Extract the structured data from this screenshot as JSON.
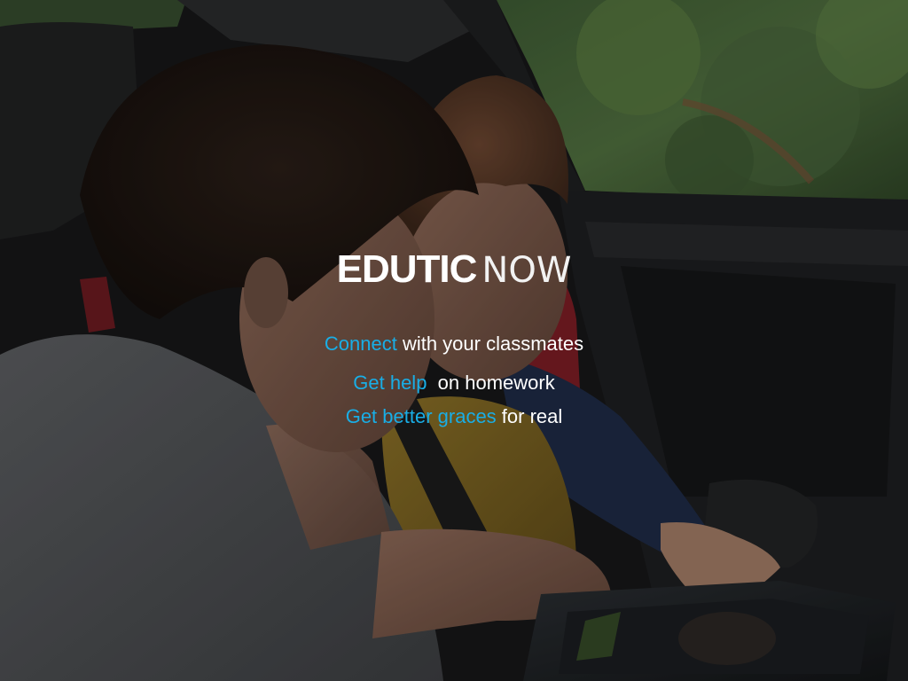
{
  "brand": {
    "bold": "EDUTIC",
    "light": "NOW"
  },
  "taglines": [
    {
      "highlight": "Connect",
      "rest": " with your classmates"
    },
    {
      "highlight": "Get help",
      "rest": "  on homework"
    },
    {
      "highlight": "Get better graces",
      "rest": " for real"
    }
  ],
  "colors": {
    "accent": "#19aee6",
    "text": "#ffffff"
  }
}
